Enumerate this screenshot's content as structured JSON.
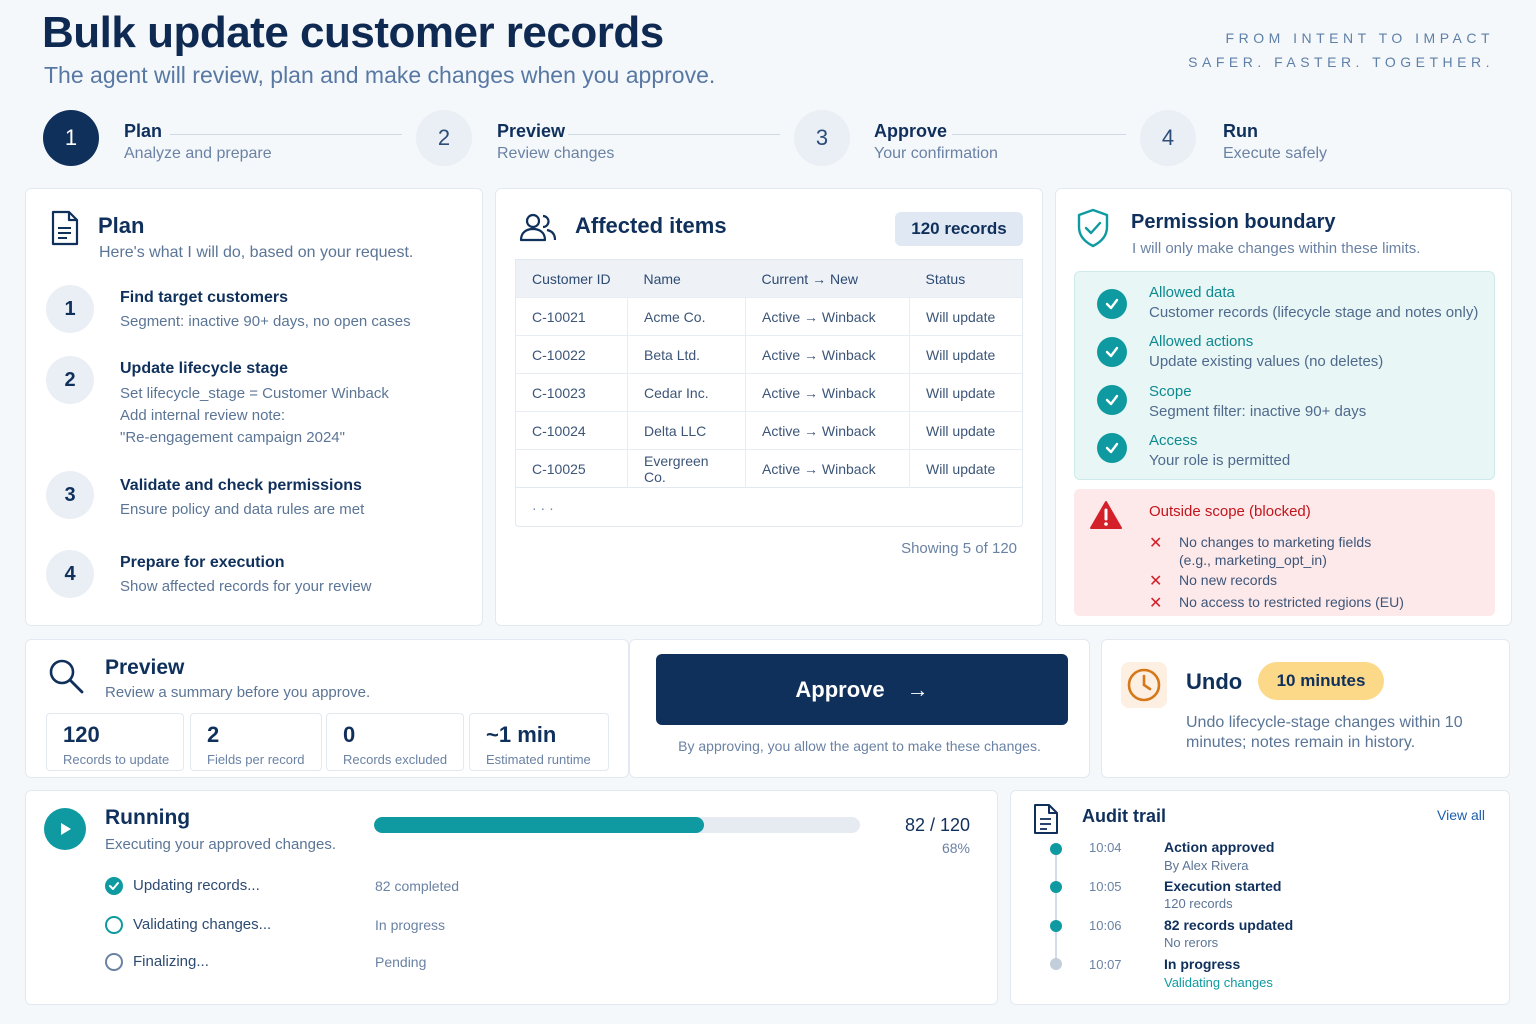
{
  "header": {
    "title": "Bulk update customer records",
    "subtitle": "The agent will review, plan and make changes when you approve.",
    "tagline_1": "FROM INTENT TO IMPACT",
    "tagline_2": "SAFER. FASTER. TOGETHER."
  },
  "steps": [
    {
      "number": "1",
      "title": "Plan",
      "subtitle": "Analyze and prepare"
    },
    {
      "number": "2",
      "title": "Preview",
      "subtitle": "Review changes"
    },
    {
      "number": "3",
      "title": "Approve",
      "subtitle": "Your confirmation"
    },
    {
      "number": "4",
      "title": "Run",
      "subtitle": "Execute safely"
    }
  ],
  "plan": {
    "title": "Plan",
    "subtitle": "Here's what I will do, based on your request.",
    "items": [
      {
        "number": "1",
        "title": "Find target customers",
        "desc_1": "Segment: inactive 90+ days, no open cases"
      },
      {
        "number": "2",
        "title": "Update lifecycle stage",
        "desc_1": "Set lifecycle_stage = Customer Winback",
        "desc_2": "Add internal review note:",
        "desc_3": "\"Re-engagement campaign 2024\""
      },
      {
        "number": "3",
        "title": "Validate and check permissions",
        "desc_1": "Ensure policy and data rules are met"
      },
      {
        "number": "4",
        "title": "Prepare for execution",
        "desc_1": "Show affected records for your review"
      }
    ]
  },
  "affected": {
    "title": "Affected items",
    "badge": "120 records",
    "columns": [
      "Customer ID",
      "Name",
      "Current → New",
      "Status"
    ],
    "rows": [
      [
        "C-10021",
        "Acme Co.",
        "Active → Winback",
        "Will update"
      ],
      [
        "C-10022",
        "Beta Ltd.",
        "Active → Winback",
        "Will update"
      ],
      [
        "C-10023",
        "Cedar Inc.",
        "Active → Winback",
        "Will update"
      ],
      [
        "C-10024",
        "Delta LLC",
        "Active → Winback",
        "Will update"
      ],
      [
        "C-10025",
        "Evergreen Co.",
        "Active → Winback",
        "Will update"
      ]
    ],
    "ellipsis": "· · ·",
    "showing": "Showing 5 of 120"
  },
  "permission": {
    "title": "Permission boundary",
    "subtitle": "I will only make changes within these limits.",
    "allowed": [
      {
        "title": "Allowed data",
        "desc": "Customer records (lifecycle stage and notes only)"
      },
      {
        "title": "Allowed actions",
        "desc": "Update existing values (no deletes)"
      },
      {
        "title": "Scope",
        "desc": "Segment filter: inactive 90+ days"
      },
      {
        "title": "Access",
        "desc": "Your role is permitted"
      }
    ],
    "blocked_title": "Outside scope (blocked)",
    "blocked": [
      {
        "line_1": "No changes to marketing fields",
        "line_2": "(e.g., marketing_opt_in)"
      },
      {
        "line_1": "No new records"
      },
      {
        "line_1": "No access to restricted regions (EU)"
      }
    ]
  },
  "preview": {
    "title": "Preview",
    "subtitle": "Review a summary before you approve.",
    "stats": [
      {
        "value": "120",
        "label": "Records to update"
      },
      {
        "value": "2",
        "label": "Fields per record"
      },
      {
        "value": "0",
        "label": "Records excluded"
      },
      {
        "value": "~1 min",
        "label": "Estimated runtime"
      }
    ]
  },
  "approve": {
    "button_label": "Approve",
    "arrow": "→",
    "note": "By approving, you allow the agent to make these changes."
  },
  "undo": {
    "title": "Undo",
    "badge": "10 minutes",
    "desc_1": "Undo lifecycle-stage changes within 10",
    "desc_2": "minutes; notes remain in history."
  },
  "running": {
    "title": "Running",
    "subtitle": "Executing your approved changes.",
    "progress_label": "82 / 120",
    "progress_percent": "68%",
    "progress_fraction": 0.68,
    "tasks": [
      {
        "label": "Updating records...",
        "status": "82 completed",
        "state": "done"
      },
      {
        "label": "Validating changes...",
        "status": "In progress",
        "state": "active"
      },
      {
        "label": "Finalizing...",
        "status": "Pending",
        "state": "pending"
      }
    ]
  },
  "audit": {
    "title": "Audit trail",
    "view_all": "View all",
    "entries": [
      {
        "time": "10:04",
        "title": "Action approved",
        "sub": "By Alex Rivera"
      },
      {
        "time": "10:05",
        "title": "Execution started",
        "sub": "120 records"
      },
      {
        "time": "10:06",
        "title": "82 records updated",
        "sub": "No rerors"
      },
      {
        "time": "10:07",
        "title": "In progress",
        "sub": "Validating changes"
      }
    ]
  },
  "colors": {
    "navy": "#10305c",
    "teal": "#0e9aa0",
    "blocked_bg": "#fde9ea",
    "blocked_red": "#d32029",
    "undo_badge": "#fcd889"
  }
}
